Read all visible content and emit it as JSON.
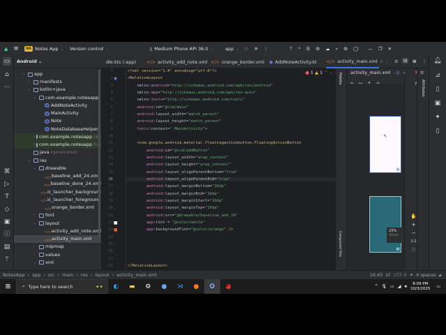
{
  "titlebar": {
    "project": "Notes App",
    "project_badge": "NA",
    "vcs": "Version control",
    "device": "Medium Phone API 36.0",
    "run_config": "app"
  },
  "tabs": [
    {
      "label": "dle.kts (:app)"
    },
    {
      "label": "activity_add_note.xml"
    },
    {
      "label": "orange_border.xml"
    },
    {
      "label": "AddNoteActivity.kt"
    },
    {
      "label": "activity_main.xml",
      "active": true
    }
  ],
  "project_panel": {
    "title": "Android",
    "tree": [
      {
        "label": "app",
        "depth": 0,
        "arrow": "open",
        "icon": "module"
      },
      {
        "label": "manifests",
        "depth": 1,
        "arrow": "closed",
        "icon": "folder"
      },
      {
        "label": "kotlin+java",
        "depth": 1,
        "arrow": "open",
        "icon": "folder"
      },
      {
        "label": "com.example.notesapp",
        "depth": 2,
        "arrow": "open",
        "icon": "package"
      },
      {
        "label": "AddNoteActivity",
        "depth": 3,
        "icon": "class"
      },
      {
        "label": "MainActivity",
        "depth": 3,
        "icon": "class"
      },
      {
        "label": "Note",
        "depth": 3,
        "icon": "class"
      },
      {
        "label": "NoteDatabaseHelper",
        "depth": 3,
        "icon": "class"
      },
      {
        "label": "com.example.notesapp",
        "suffix": "(andro",
        "depth": 2,
        "arrow": "closed",
        "icon": "package",
        "green": true
      },
      {
        "label": "com.example.notesapp",
        "suffix": "(test)",
        "depth": 2,
        "arrow": "closed",
        "icon": "package",
        "green": true
      },
      {
        "label": "java",
        "suffix": "(generated)",
        "depth": 1,
        "icon": "folder"
      },
      {
        "label": "res",
        "depth": 1,
        "arrow": "open",
        "icon": "folder"
      },
      {
        "label": "drawable",
        "depth": 2,
        "arrow": "open",
        "icon": "folder"
      },
      {
        "label": "baseline_add_24.xml",
        "depth": 3,
        "icon": "xml"
      },
      {
        "label": "baseline_done_24.xml",
        "depth": 3,
        "icon": "xml"
      },
      {
        "label": "ic_launcher_background.xml",
        "depth": 3,
        "icon": "xml"
      },
      {
        "label": "ic_launcher_foreground.xml",
        "depth": 3,
        "icon": "xml"
      },
      {
        "label": "orange_border.xml",
        "depth": 3,
        "icon": "xml"
      },
      {
        "label": "font",
        "depth": 2,
        "arrow": "closed",
        "icon": "folder"
      },
      {
        "label": "layout",
        "depth": 2,
        "arrow": "open",
        "icon": "folder"
      },
      {
        "label": "activity_add_note.xml",
        "depth": 3,
        "icon": "xml"
      },
      {
        "label": "activity_main.xml",
        "depth": 3,
        "icon": "xml",
        "selected": true
      },
      {
        "label": "mipmap",
        "depth": 2,
        "arrow": "closed",
        "icon": "folder"
      },
      {
        "label": "values",
        "depth": 2,
        "arrow": "closed",
        "icon": "folder"
      },
      {
        "label": "xml",
        "depth": 2,
        "arrow": "open",
        "icon": "folder"
      }
    ]
  },
  "editor": {
    "errors": "1",
    "warnings": "1",
    "current_line": 16,
    "lines": [
      [
        [
          "tag",
          "<?xml version=\"1.0\" encoding=\"utf-8\"?>"
        ]
      ],
      [
        [
          "tag",
          "<RelativeLayout"
        ]
      ],
      [
        [
          "attr",
          "    xmlns:"
        ],
        [
          "ns",
          "android"
        ],
        [
          "attr",
          "="
        ],
        [
          "str",
          "\"http://schemas.android.com/apk/res/android\""
        ]
      ],
      [
        [
          "attr",
          "    xmlns:"
        ],
        [
          "ns",
          "app"
        ],
        [
          "attr",
          "="
        ],
        [
          "str",
          "\"http://schemas.android.com/apk/res-auto\""
        ]
      ],
      [
        [
          "attr",
          "    xmlns:"
        ],
        [
          "ns",
          "tools"
        ],
        [
          "attr",
          "="
        ],
        [
          "str",
          "\"http://schemas.android.com/tools\""
        ]
      ],
      [
        [
          "ns",
          "    android"
        ],
        [
          "attr",
          ":id="
        ],
        [
          "str",
          "\"@+id/main\""
        ]
      ],
      [
        [
          "ns",
          "    android"
        ],
        [
          "attr",
          ":layout_width="
        ],
        [
          "str",
          "\"match_parent\""
        ]
      ],
      [
        [
          "ns",
          "    android"
        ],
        [
          "attr",
          ":layout_height="
        ],
        [
          "str",
          "\"match_parent\""
        ]
      ],
      [
        [
          "ns",
          "    tools"
        ],
        [
          "attr",
          ":context="
        ],
        [
          "str",
          "\".MainActivity\""
        ],
        [
          "tag",
          ">"
        ]
      ],
      [],
      [
        [
          "tag",
          "    <com.google.android.material.floatingactionbutton.FloatingActionButton"
        ]
      ],
      [
        [
          "ns",
          "        android"
        ],
        [
          "attr",
          ":id="
        ],
        [
          "str",
          "\"@+id/addButton\""
        ]
      ],
      [
        [
          "ns",
          "        android"
        ],
        [
          "attr",
          ":layout_width="
        ],
        [
          "str",
          "\"wrap_content\""
        ]
      ],
      [
        [
          "ns",
          "        android"
        ],
        [
          "attr",
          ":layout_height="
        ],
        [
          "str",
          "\"wrap_content\""
        ]
      ],
      [
        [
          "ns",
          "        android"
        ],
        [
          "attr",
          ":layout_alignParentBottom="
        ],
        [
          "str",
          "\"true\""
        ]
      ],
      [
        [
          "ns",
          "        android"
        ],
        [
          "attr",
          ":layout_alignParentEnd="
        ],
        [
          "str",
          "\"true\""
        ]
      ],
      [
        [
          "ns",
          "        android"
        ],
        [
          "attr",
          ":layout_marginBottom="
        ],
        [
          "str",
          "\"16dp\""
        ]
      ],
      [
        [
          "ns",
          "        android"
        ],
        [
          "attr",
          ":layout_marginEnd="
        ],
        [
          "str",
          "\"16dp\""
        ]
      ],
      [
        [
          "ns",
          "        android"
        ],
        [
          "attr",
          ":layout_marginStart="
        ],
        [
          "str",
          "\"16dp\""
        ]
      ],
      [
        [
          "ns",
          "        android"
        ],
        [
          "attr",
          ":layout_marginTop="
        ],
        [
          "str",
          "\"16dp\""
        ]
      ],
      [
        [
          "ns",
          "        android"
        ],
        [
          "attr",
          ":src="
        ],
        [
          "str",
          "\"@drawable/baseline_add_24\""
        ]
      ],
      [
        [
          "ns",
          "        app"
        ],
        [
          "attr",
          ":tint = "
        ],
        [
          "str",
          "\"@color/white\""
        ]
      ],
      [
        [
          "ns",
          "        app"
        ],
        [
          "attr",
          ":backgroundTint="
        ],
        [
          "str",
          "\"@color/orange\""
        ],
        [
          "tag",
          " />"
        ]
      ],
      [],
      [],
      [],
      [],
      [
        [
          "tag",
          "</RelativeLayout>"
        ]
      ]
    ]
  },
  "design": {
    "file": "activity_main.xml",
    "palette": "Palette",
    "attributes": "Attributes",
    "component_tree": "Component Tree",
    "zoom": "23%",
    "reset": "Reset",
    "zoom_1to1": "1:1"
  },
  "statusbar": {
    "breadcrumb": [
      "NotesApp",
      "app",
      "src",
      "main",
      "res",
      "layout",
      "activity_main.xml"
    ],
    "position": "16:45",
    "line_sep": "LF",
    "encoding": "UTF-8",
    "indent": "4 spaces"
  },
  "taskbar": {
    "search_placeholder": "Type here to search",
    "time": "8:09 PM",
    "date": "10/3/2025"
  },
  "colors": {
    "accent": "#3574f0",
    "blueprint": "#2a6a78",
    "badge": "#e8b53a"
  }
}
